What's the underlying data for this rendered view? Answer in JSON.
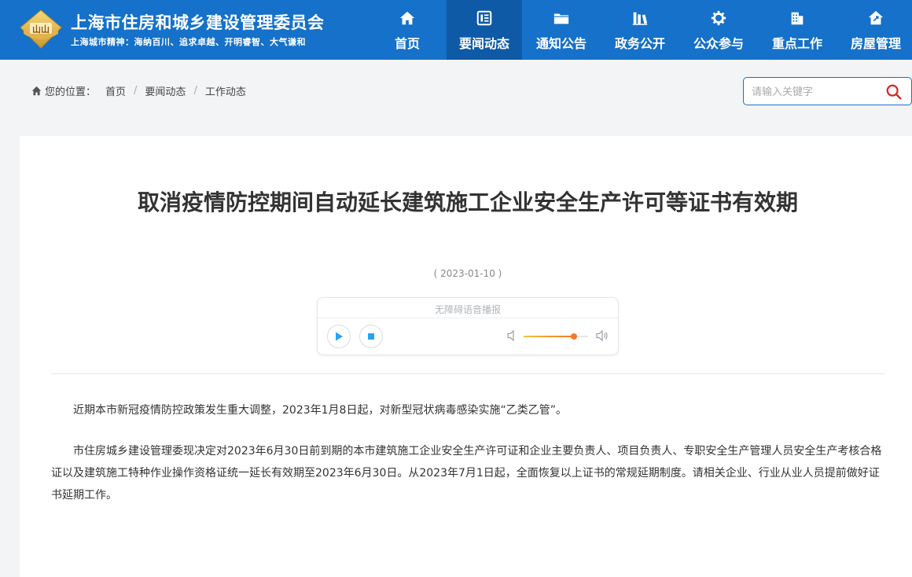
{
  "header": {
    "site_title": "上海市住房和城乡建设管理委员会",
    "slogan": "上海城市精神：海纳百川、追求卓越、开明睿智、大气谦和",
    "emblem_text": "山山",
    "brand_color": "#1571c9",
    "active_color": "#0e5aa6"
  },
  "nav": {
    "items": [
      {
        "label": "首页",
        "icon": "home-icon"
      },
      {
        "label": "要闻动态",
        "icon": "news-icon",
        "active": true
      },
      {
        "label": "通知公告",
        "icon": "folder-icon"
      },
      {
        "label": "政务公开",
        "icon": "books-icon"
      },
      {
        "label": "公众参与",
        "icon": "gear-icon"
      },
      {
        "label": "重点工作",
        "icon": "building-icon"
      },
      {
        "label": "房屋管理",
        "icon": "house-icon"
      }
    ]
  },
  "breadcrumb": {
    "location_label": "您的位置：",
    "items": [
      "首页",
      "要闻动态",
      "工作动态"
    ],
    "separator": "/"
  },
  "search": {
    "placeholder": "请输入关键字",
    "value": ""
  },
  "article": {
    "title": "取消疫情防控期间自动延长建筑施工企业安全生产许可等证书有效期",
    "date": "( 2023-01-10 )",
    "paragraphs": [
      "近期本市新冠疫情防控政策发生重大调整，2023年1月8日起，对新型冠状病毒感染实施“乙类乙管”。",
      "市住房城乡建设管理委现决定对2023年6月30日前到期的本市建筑施工企业安全生产许可证和企业主要负责人、项目负责人、专职安全生产管理人员安全生产考核合格证以及建筑施工特种作业操作资格证统一延长有效期至2023年6月30日。从2023年7月1日起，全面恢复以上证书的常规延期制度。请相关企业、行业从业人员提前做好证书延期工作。"
    ]
  },
  "player": {
    "title": "无障碍语音播报",
    "volume": 0.78,
    "play_icon": "play-icon",
    "stop_icon": "stop-icon"
  }
}
